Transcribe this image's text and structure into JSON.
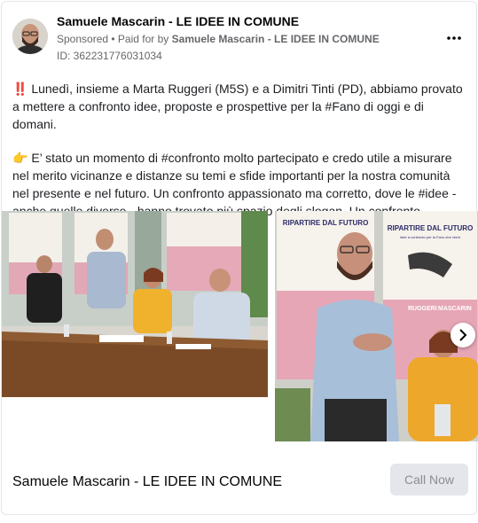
{
  "header": {
    "page_name": "Samuele Mascarin - LE IDEE IN COMUNE",
    "sponsored": "Sponsored",
    "paid_for_prefix": "• Paid for by",
    "paid_for_name": "Samuele Mascarin - LE IDEE IN COMUNE",
    "ad_id": "ID: 362231776031034",
    "more_icon": "more-horizontal-icon"
  },
  "post": {
    "paragraph1": "‼️ Lunedì, insieme a Marta Ruggeri (M5S) e a Dimitri Tinti (PD), abbiamo provato a mettere a confronto idee, proposte e prospettive per la #Fano di oggi e di domani.",
    "paragraph2": "👉 E’ stato un momento di #confronto molto partecipato e credo utile a misurare nel merito vicinanze e distanze su temi e sfide importanti per la nostra comunità nel presente e nel futuro. Un confronto appassionato ma corretto, dove le #idee - anche quelle diverse - hanno trovato più spazio degli slogan. Un confronto…"
  },
  "gallery": {
    "poster_title": "RIPARTIRE DAL FUTURO",
    "poster_subtitle": "idee a confronto per la Fano che verrà",
    "poster_names": [
      "RUGGERI",
      "MASCARIN"
    ],
    "next_icon": "chevron-right-icon"
  },
  "footer": {
    "page_name": "Samuele Mascarin - LE IDEE IN COMUNE",
    "cta_label": "Call Now"
  }
}
